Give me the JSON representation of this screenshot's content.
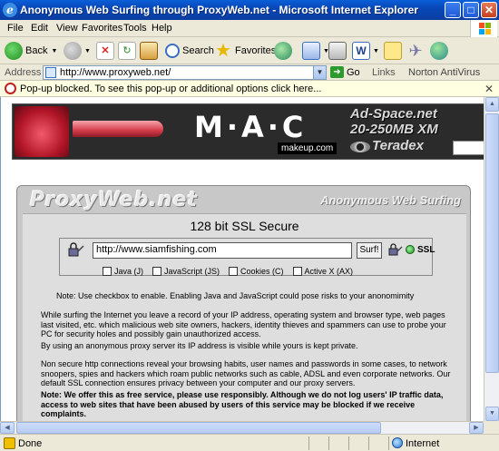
{
  "window": {
    "title": "Anonymous Web Surfing through ProxyWeb.net - Microsoft Internet Explorer",
    "controls": {
      "minimize": "_",
      "maximize": "□",
      "close": "✕"
    }
  },
  "menu": [
    "File",
    "Edit",
    "View",
    "Favorites",
    "Tools",
    "Help"
  ],
  "toolbar": {
    "back_label": "Back",
    "search_label": "Search",
    "favorites_label": "Favorites"
  },
  "address": {
    "label": "Address",
    "url": "http://www.proxyweb.net/",
    "go_label": "Go",
    "links_label": "Links",
    "norton_label": "Norton AntiVirus"
  },
  "popup": {
    "message": "Pop-up blocked. To see this pop-up or additional options click here..."
  },
  "banner": {
    "brand": "M·A·C",
    "brand_sub": "makeup.com",
    "ad_line1": "Ad-Space.net",
    "ad_line2": "20-250MB XM",
    "ad_line3": "Teradex"
  },
  "proxy": {
    "logo": "ProxyWeb.net",
    "tagline": "Anonymous Web Surfing",
    "ssl_heading": "128 bit SSL Secure",
    "url_value": "http://www.siamfishing.com",
    "surf_button": "Surf!",
    "ssl_label": "SSL",
    "checkboxes": [
      "Java (J)",
      "JavaScript (JS)",
      "Cookies (C)",
      "Active X (AX)"
    ],
    "note": "Note: Use checkbox to enable. Enabling Java and JavaScript could pose risks to your anonomimity",
    "para1": "While surfing the Internet you leave a record of your IP address, operating system and browser type, web pages last visited, etc. which malicious web site owners, hackers, identity thieves and spammers can use to probe your PC for security holes and possibly gain unauthorized access.",
    "para2": "By using an anonymous proxy server its IP address is visible while yours is kept private.",
    "para3": "Non secure http connections reveal your browsing habits, user names and passwords in some cases, to network snoopers, spies and hackers which roam public networks such as cable, ADSL and even corporate networks. Our default SSL connection ensures privacy between your computer and our proxy servers.",
    "para4": "Note: We offer this as free service, please use responsibly. Although we do not log users' IP traffic data, access to web sites that have been abused by users of this service may be blocked if we receive complaints."
  },
  "status": {
    "text": "Done",
    "zone": "Internet"
  }
}
